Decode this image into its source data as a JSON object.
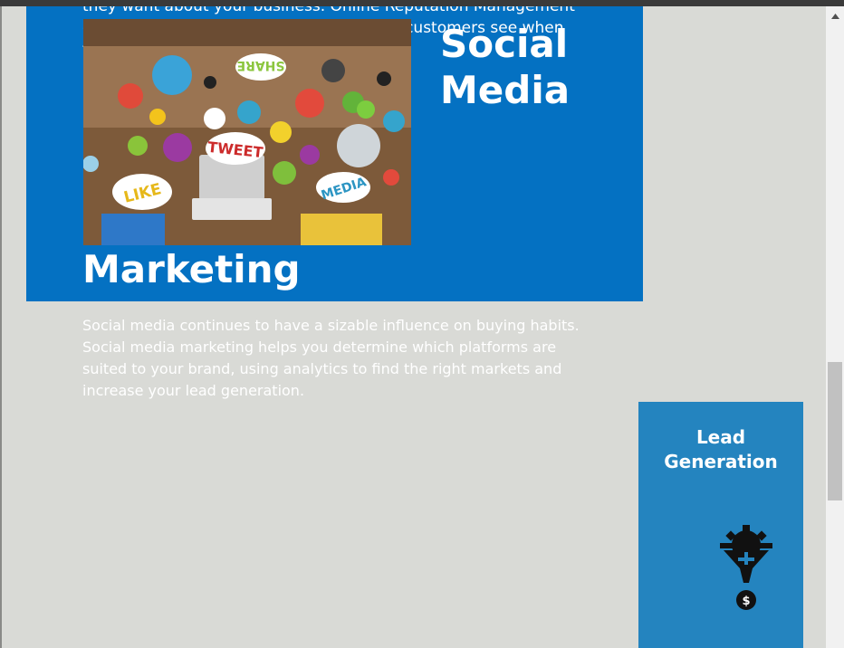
{
  "intro_paragraph": "they want about your business. Online Reputation Management gives you the control over what potential customers see when they search for your business.",
  "section": {
    "title_line1": "Social",
    "title_line2": "Media",
    "title_line3": "Marketing",
    "description": "Social media continues to have a sizable influence on buying habits. Social media marketing helps you determine which platforms are suited to your brand, using analytics to find the right markets and increase your lead generation.",
    "image_labels": [
      "SHARE",
      "TWEET",
      "LIKE",
      "MEDIA"
    ]
  },
  "lead_card": {
    "title": "Lead Generation",
    "icon": "gear-funnel-dollar-icon"
  },
  "scrollbar": {
    "up_icon": "scroll-up-arrow-icon"
  },
  "colors": {
    "page_background": "#d9dad6",
    "section_blue": "#0471c2",
    "card_blue": "#2484bf"
  }
}
